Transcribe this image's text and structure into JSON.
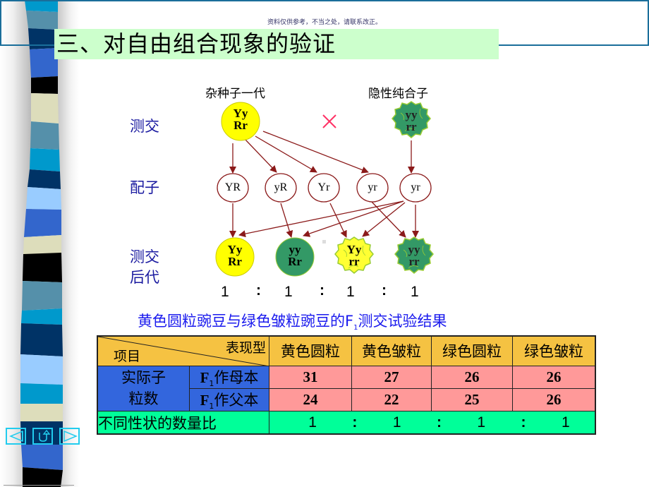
{
  "watermark": "资料仅供参考，不当之处，请联系改正。",
  "title": "三、对自由组合现象的验证",
  "diagram": {
    "parent_labels": {
      "hybrid": "杂种子一代",
      "recessive": "隐性纯合子"
    },
    "row_labels": {
      "testcross": "测交",
      "gametes": "配子",
      "offspring_line1": "测交",
      "offspring_line2": "后代"
    },
    "cross_symbol": "×",
    "parents": [
      {
        "line1": "Yy",
        "line2": "Rr",
        "color": "yellow",
        "shape": "round"
      },
      {
        "line1": "yy",
        "line2": "rr",
        "color": "green",
        "shape": "wrinkled"
      }
    ],
    "gametes": [
      "YR",
      "yR",
      "Yr",
      "yr",
      "yr"
    ],
    "offspring": [
      {
        "line1": "Yy",
        "line2": "Rr",
        "color": "yellow",
        "shape": "round"
      },
      {
        "line1": "yy",
        "line2": "Rr",
        "color": "green",
        "shape": "round"
      },
      {
        "line1": "Yy",
        "line2": "rr",
        "color": "yellow",
        "shape": "wrinkled"
      },
      {
        "line1": "yy",
        "line2": "rr",
        "color": "green",
        "shape": "wrinkled"
      }
    ],
    "ratio": [
      "1",
      ":",
      "1",
      ":",
      "1",
      ":",
      "1"
    ]
  },
  "caption": {
    "before": "黄色圆粒豌豆与绿色皱粒豌豆的F",
    "sub": "1",
    "after": "测交试验结果"
  },
  "table": {
    "corner_top": "表现型",
    "corner_bottom": "项目",
    "columns": [
      "黄色圆粒",
      "黄色皱粒",
      "绿色圆粒",
      "绿色皱粒"
    ],
    "group_label_line1": "实际子",
    "group_label_line2": "粒数",
    "rows": [
      {
        "label_prefix": "F",
        "label_sub": "1",
        "label_suffix": "作母本",
        "values": [
          "31",
          "27",
          "26",
          "26"
        ]
      },
      {
        "label_prefix": "F",
        "label_sub": "1",
        "label_suffix": "作父本",
        "values": [
          "24",
          "22",
          "25",
          "26"
        ]
      }
    ],
    "ratio_label": "不同性状的数量比",
    "ratio_values": [
      "1",
      ":",
      "1",
      ":",
      "1",
      ":",
      "1"
    ]
  },
  "nav": {
    "prev": "previous",
    "return": "return",
    "next": "next"
  },
  "colors": {
    "header_border": "#1a6e9a",
    "title_bg": "#ccffcc",
    "label_blue": "#1a1aa0",
    "arrow": "#8b1a1a",
    "yellow_pea": "#ffff00",
    "green_pea": "#339966",
    "table_header": "#f5c242",
    "table_blue": "#3366dd",
    "table_pink": "#ff9999",
    "table_green": "#00ff99",
    "cross_mark": "#ff3366",
    "nav": "#22ccee"
  }
}
